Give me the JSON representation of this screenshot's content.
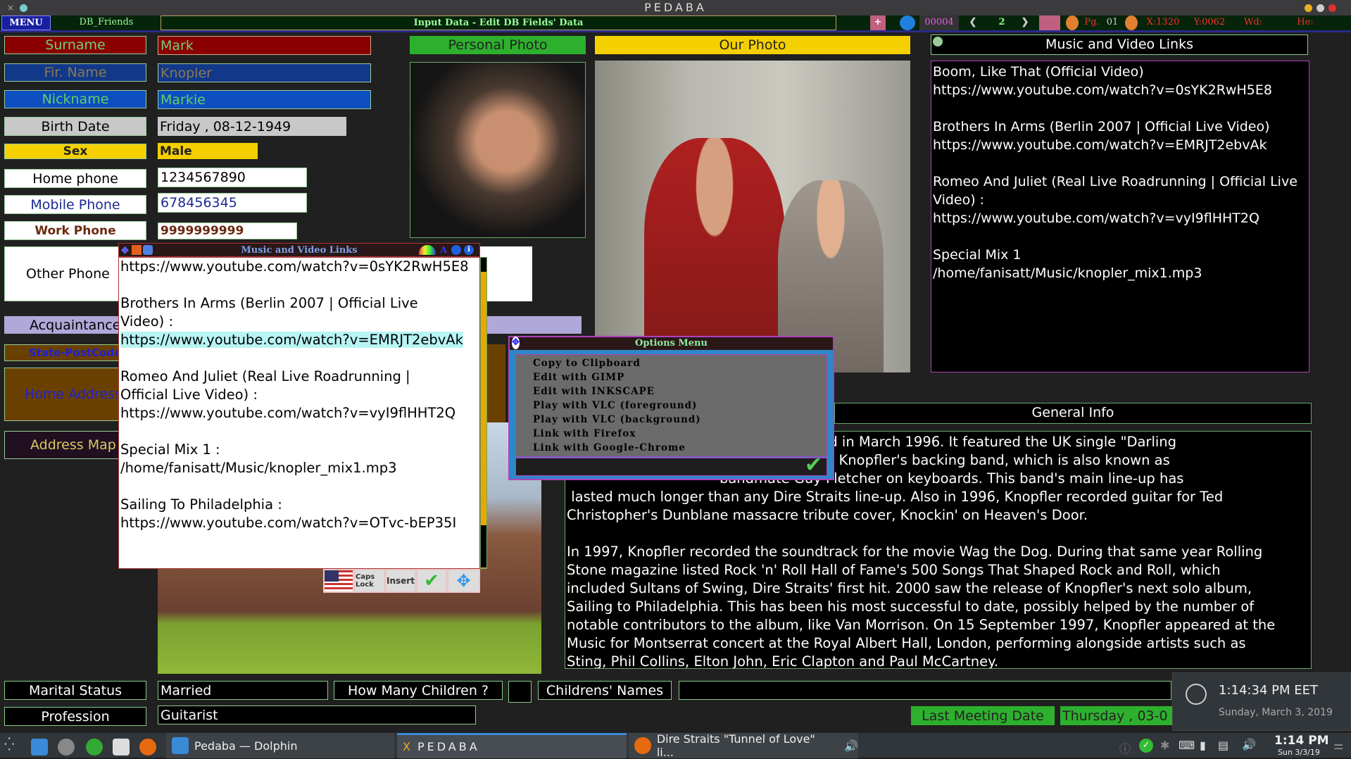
{
  "window": {
    "title": "PEDABA"
  },
  "toolbar": {
    "menu": "MENU",
    "db_name": "DB_Friends",
    "mode": "Input Data - Edit DB Fields' Data",
    "record": "00004",
    "page_nav": "2",
    "pg_label": "Pg.",
    "pg_value": "01",
    "x_label": "X:1320",
    "y_label": "Y:0062",
    "wd_label": "Wd:",
    "he_label": "He:"
  },
  "fields": [
    {
      "label": "Surname",
      "value": "Mark"
    },
    {
      "label": "Fir. Name",
      "value": "Knopler"
    },
    {
      "label": "Nickname",
      "value": "Markie"
    },
    {
      "label": "Birth Date",
      "value": "Friday , 08-12-1949"
    },
    {
      "label": "Sex",
      "value": "Male"
    },
    {
      "label": "Home phone",
      "value": "1234567890"
    },
    {
      "label": "Mobile Phone",
      "value": "678456345"
    },
    {
      "label": "Work Phone",
      "value": "9999999999"
    },
    {
      "label": "Other Phone",
      "value": ""
    },
    {
      "label": "Acquaintance",
      "value": ""
    },
    {
      "label": "State-PostCode",
      "value": ""
    },
    {
      "label": "Home Address",
      "value": ""
    },
    {
      "label": "Address Map",
      "value": ""
    }
  ],
  "photos": {
    "personal": "Personal Photo",
    "our": "Our Photo"
  },
  "links_panel": {
    "title": "Music and Video Links",
    "content": "Boom, Like That (Official Video)\nhttps://www.youtube.com/watch?v=0sYK2RwH5E8\n\nBrothers In Arms (Berlin 2007 | Official Live Video)\nhttps://www.youtube.com/watch?v=EMRJT2ebvAk\n\nRomeo And Juliet (Real Live Roadrunning | Official Live Video) :\nhttps://www.youtube.com/watch?v=vyI9flHHT2Q\n\nSpecial Mix 1\n/home/fanisatt/Music/knopler_mix1.mp3"
  },
  "popup": {
    "title": "Music and Video Links",
    "line1": "https://www.youtube.com/watch?v=0sYK2RwH5E8\n\nBrothers In Arms (Berlin 2007 | Official Live\nVideo) :\n",
    "highlighted": "https://www.youtube.com/watch?v=EMRJT2ebvAk",
    "line2": "\n\nRomeo And Juliet (Real Live Roadrunning |\nOfficial Live Video) :\nhttps://www.youtube.com/watch?v=vyI9flHHT2Q\n\nSpecial Mix 1 :\n/home/fanisatt/Music/knopler_mix1.mp3\n\nSailing To Philadelphia :\nhttps://www.youtube.com/watch?v=OTvc-bEP35I",
    "caps_lock": "Caps Lock",
    "insert": "Insert"
  },
  "options_menu": {
    "title": "Options Menu",
    "items": [
      "Copy to Clipboard",
      "Edit with GIMP",
      "Edit with INKSCAPE",
      "Play with VLC (foreground)",
      "Play with VLC (background)",
      "Link with Firefox",
      "Link with Google-Chrome"
    ]
  },
  "general_info": {
    "title": "General Info",
    "text": "                                   art, was released in March 1996. It featured the UK single \"Darling\n                                   ns helped create Knopfler's backing band, which is also known as\n                                   bandmate Guy Fletcher on keyboards. This band's main line-up has\n lasted much longer than any Dire Straits line-up. Also in 1996, Knopfler recorded guitar for Ted\nChristopher's Dunblane massacre tribute cover, Knockin' on Heaven's Door.\n\nIn 1997, Knopfler recorded the soundtrack for the movie Wag the Dog. During that same year Rolling\nStone magazine listed Rock 'n' Roll Hall of Fame's 500 Songs That Shaped Rock and Roll, which\nincluded Sultans of Swing, Dire Straits' first hit. 2000 saw the release of Knopfler's next solo album,\nSailing to Philadelphia. This has been his most successful to date, possibly helped by the number of\nnotable contributors to the album, like Van Morrison. On 15 September 1997, Knopfler appeared at the\nMusic for Montserrat concert at the Royal Albert Hall, London, performing alongside artists such as\nSting, Phil Collins, Elton John, Eric Clapton and Paul McCartney."
  },
  "bottom": {
    "marital_label": "Marital Status",
    "marital_value": "Married",
    "children_label": "How Many Children ?",
    "children_value": "",
    "names_label": "Childrens' Names",
    "names_value": "",
    "profession_label": "Profession",
    "profession_value": "Guitarist",
    "last_meeting_label": "Last Meeting Date",
    "last_meeting_value": "Thursday , 03-0"
  },
  "clock_popup": {
    "time": "1:14:34 PM EET",
    "date": "Sunday, March 3, 2019"
  },
  "taskbar": {
    "tasks": [
      "Pedaba — Dolphin",
      "PEDABA",
      "Dire Straits \"Tunnel of Love\" li..."
    ],
    "time": "1:14 PM",
    "date": "Sun 3/3/19"
  }
}
